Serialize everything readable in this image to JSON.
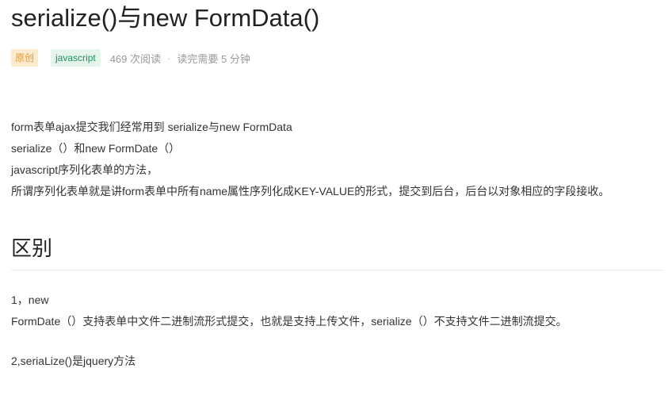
{
  "article": {
    "title": "serialize()与new FormData()",
    "meta": {
      "original_badge": "原创",
      "tag": "javascript",
      "views": "469 次阅读",
      "separator": "·",
      "read_time": "读完需要 5 分钟"
    },
    "intro": [
      "form表单ajax提交我们经常用到 serialize与new FormData",
      "serialize（）和new FormDate（）",
      "javascript序列化表单的方法，",
      "所谓序列化表单就是讲form表单中所有name属性序列化成KEY-VALUE的形式，提交到后台，后台以对象相应的字段接收。"
    ],
    "section_heading": "区别",
    "difference": [
      "1，new",
      "FormDate（）支持表单中文件二进制流形式提交，也就是支持上传文件，serialize（）不支持文件二进制流提交。"
    ],
    "difference2": "2,seriaLize()是jquery方法"
  }
}
